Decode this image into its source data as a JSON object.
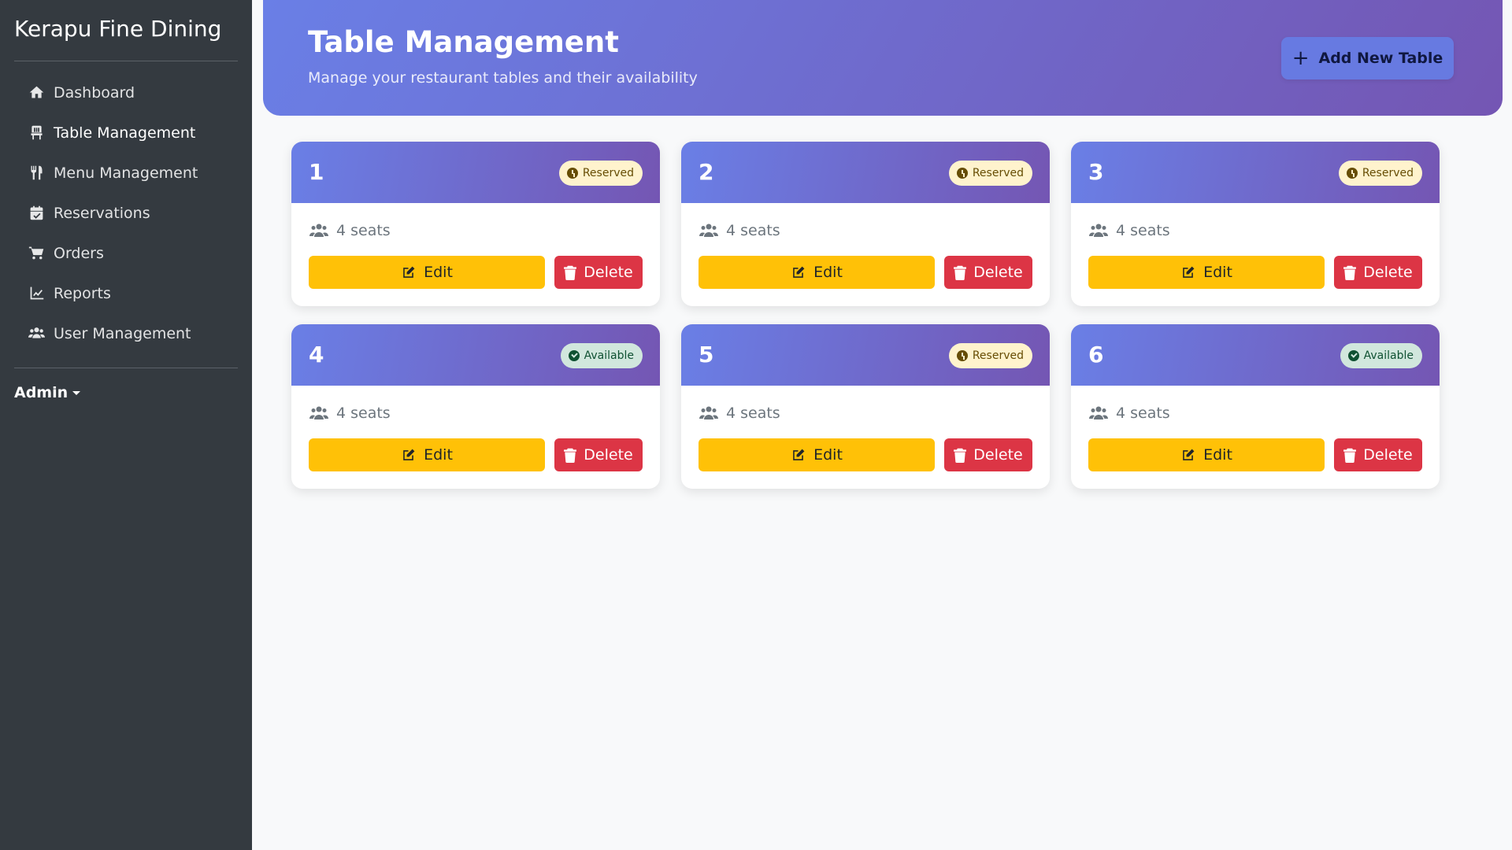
{
  "brand": "Kerapu Fine Dining",
  "sidebar": {
    "items": [
      {
        "label": "Dashboard",
        "icon": "home-icon"
      },
      {
        "label": "Table Management",
        "icon": "chair-icon"
      },
      {
        "label": "Menu Management",
        "icon": "utensils-icon"
      },
      {
        "label": "Reservations",
        "icon": "calendar-icon"
      },
      {
        "label": "Orders",
        "icon": "cart-icon"
      },
      {
        "label": "Reports",
        "icon": "chart-line-icon"
      },
      {
        "label": "User Management",
        "icon": "users-icon"
      }
    ],
    "active": "Table Management",
    "user_menu": "Admin"
  },
  "header": {
    "title": "Table Management",
    "subtitle": "Manage your restaurant tables and their availability",
    "add_button": "Add New Table"
  },
  "tables": [
    {
      "number": "1",
      "status": "Reserved",
      "seats": "4 seats",
      "edit": "Edit",
      "delete": "Delete"
    },
    {
      "number": "2",
      "status": "Reserved",
      "seats": "4 seats",
      "edit": "Edit",
      "delete": "Delete"
    },
    {
      "number": "3",
      "status": "Reserved",
      "seats": "4 seats",
      "edit": "Edit",
      "delete": "Delete"
    },
    {
      "number": "4",
      "status": "Available",
      "seats": "4 seats",
      "edit": "Edit",
      "delete": "Delete"
    },
    {
      "number": "5",
      "status": "Reserved",
      "seats": "4 seats",
      "edit": "Edit",
      "delete": "Delete"
    },
    {
      "number": "6",
      "status": "Available",
      "seats": "4 seats",
      "edit": "Edit",
      "delete": "Delete"
    }
  ],
  "colors": {
    "sidebar_bg": "#343a40",
    "header_gradient_start": "#6a7fe6",
    "header_gradient_end": "#7456b3",
    "edit_button": "#ffc107",
    "delete_button": "#dc3545",
    "reserved_badge_bg": "#fff3cd",
    "available_badge_bg": "#d1e7dd",
    "page_bg": "#f8f9fa"
  }
}
